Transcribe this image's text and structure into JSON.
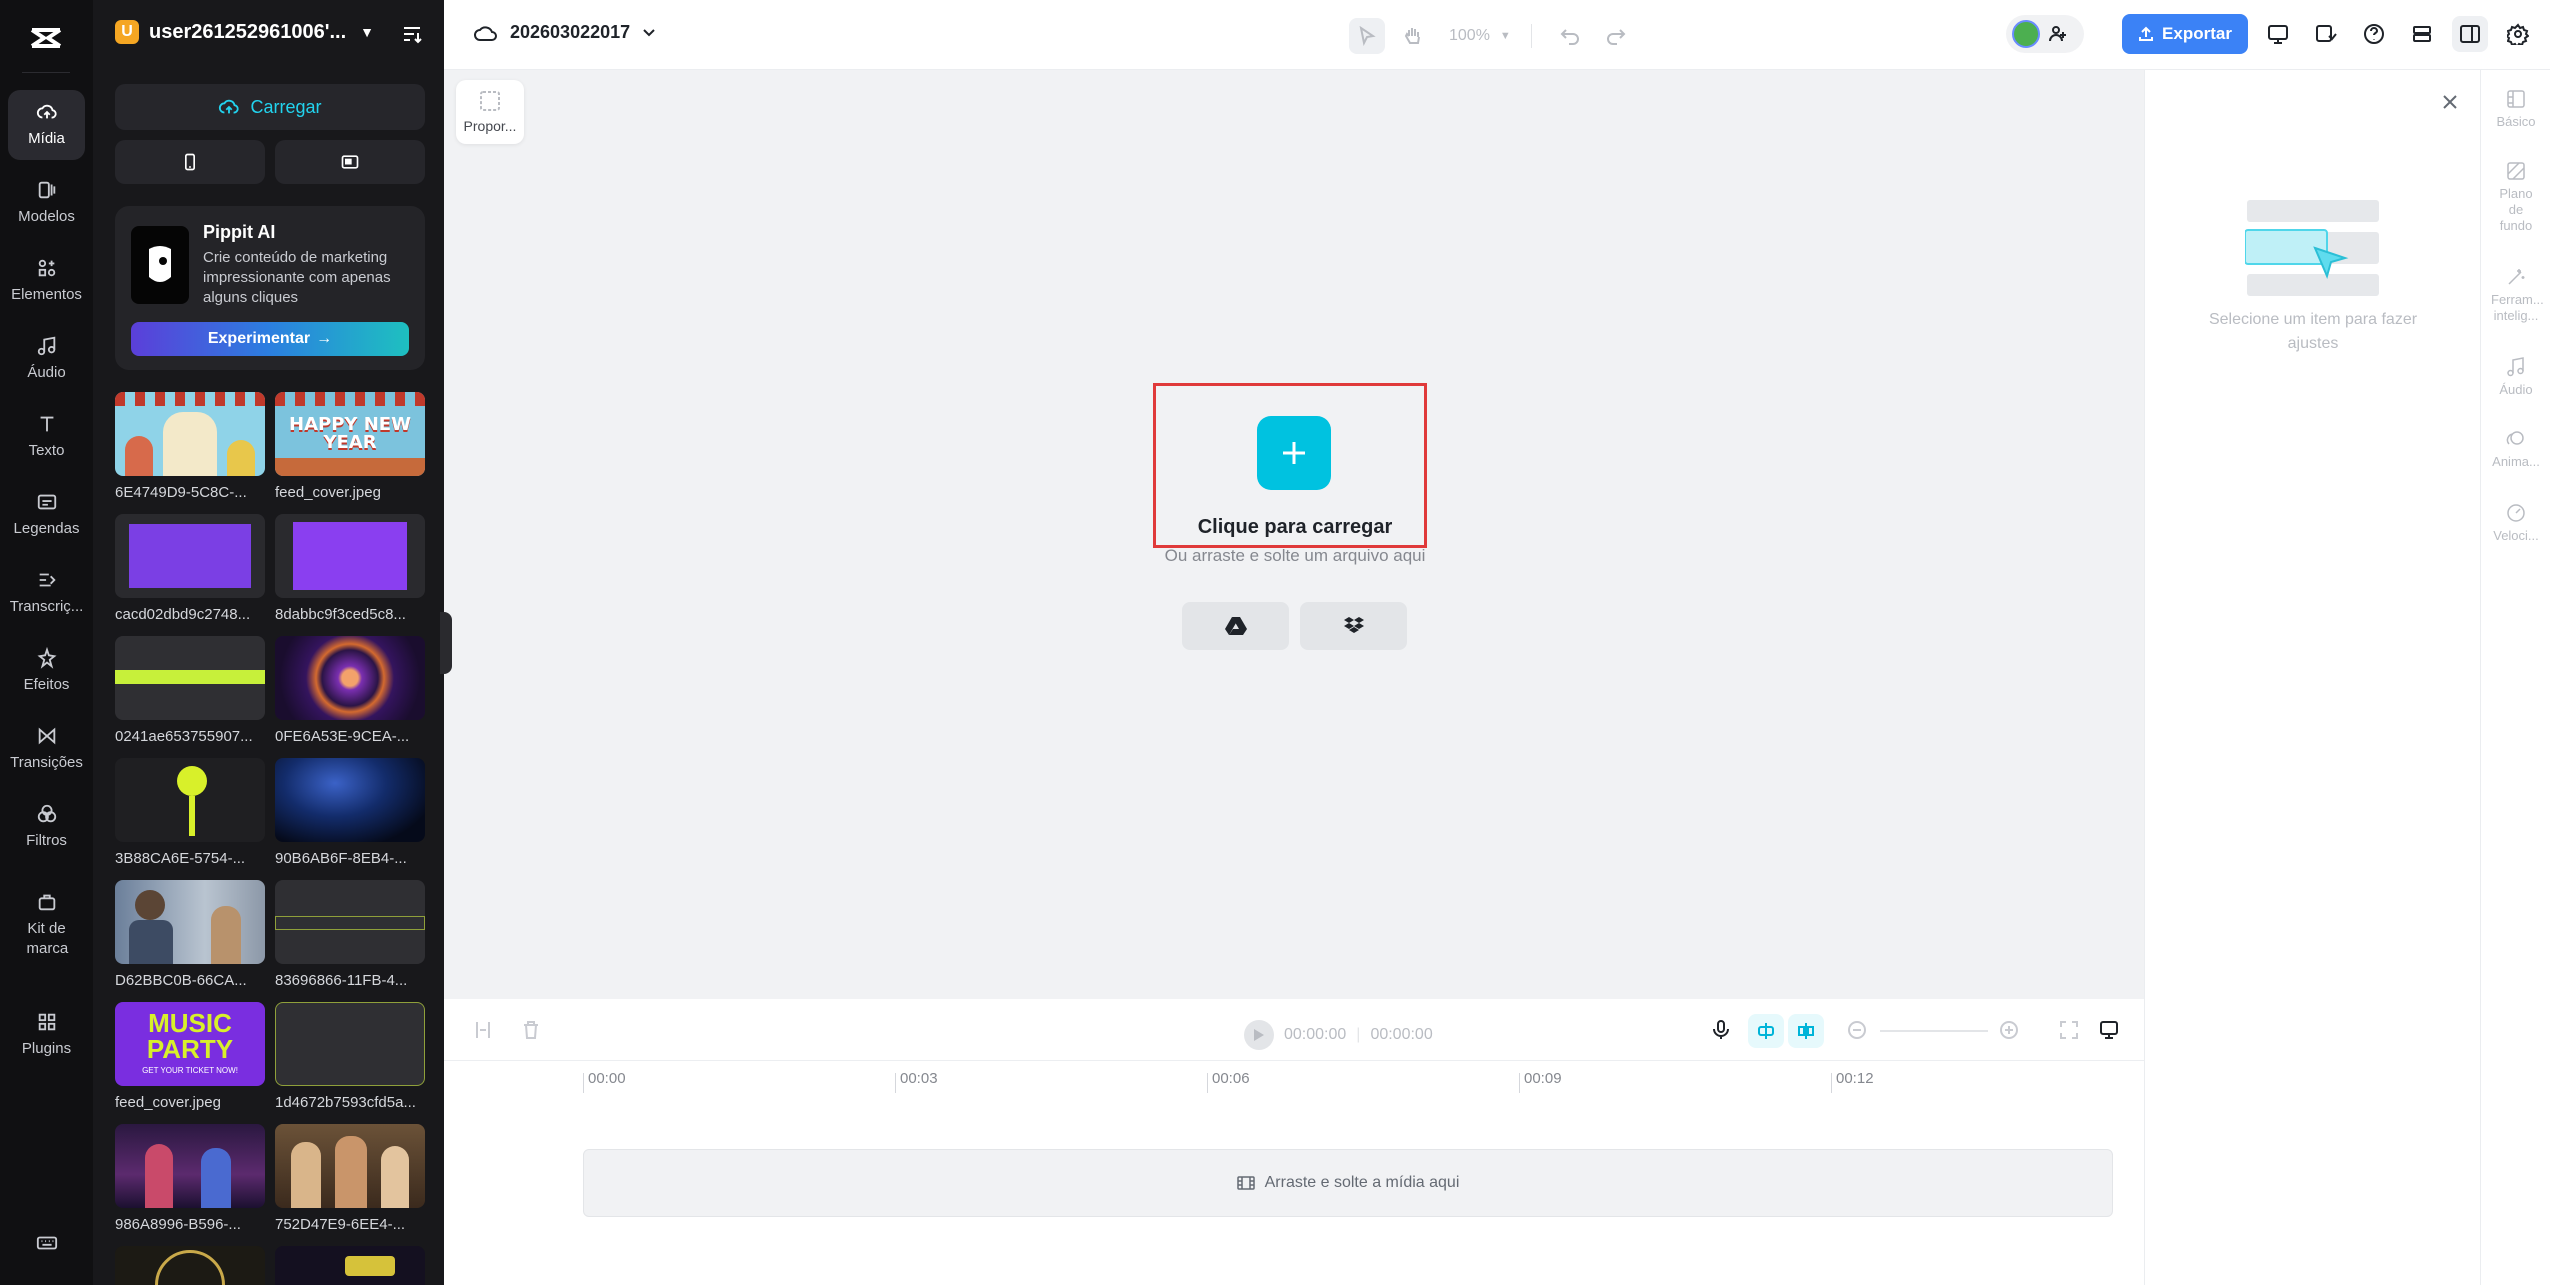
{
  "brand": {
    "accent": "#00c2e0",
    "export_color": "#3b82f6",
    "highlight": "#e03a3a"
  },
  "rail": {
    "items": [
      {
        "label": "Mídia",
        "icon": "cloud-upload-icon",
        "active": true
      },
      {
        "label": "Modelos",
        "icon": "templates-icon"
      },
      {
        "label": "Elementos",
        "icon": "elements-icon"
      },
      {
        "label": "Áudio",
        "icon": "music-note-icon"
      },
      {
        "label": "Texto",
        "icon": "text-icon"
      },
      {
        "label": "Legendas",
        "icon": "captions-icon"
      },
      {
        "label": "Transcriç...",
        "icon": "transcript-icon"
      },
      {
        "label": "Efeitos",
        "icon": "effects-icon"
      },
      {
        "label": "Transições",
        "icon": "transitions-icon"
      },
      {
        "label": "Filtros",
        "icon": "filters-icon"
      },
      {
        "label": "Kit de marca",
        "icon": "brand-kit-icon"
      },
      {
        "label": "Plugins",
        "icon": "plugins-icon"
      }
    ]
  },
  "panel": {
    "workspace_initial": "U",
    "workspace_name": "user261252961006'...",
    "upload_label": "Carregar",
    "promo": {
      "title": "Pippit AI",
      "description": "Crie conteúdo de marketing impressionante com apenas alguns cliques",
      "button": "Experimentar"
    },
    "media": [
      "6E4749D9-5C8C-...",
      "feed_cover.jpeg",
      "cacd02dbd9c2748...",
      "8dabbc9f3ced5c8...",
      "0241ae653755907...",
      "0FE6A53E-9CEA-...",
      "3B88CA6E-5754-...",
      "90B6AB6F-8EB4-...",
      "D62BBC0B-66CA...",
      "83696866-11FB-4...",
      "feed_cover.jpeg",
      "1d4672b7593cfd5a...",
      "986A8996-B596-...",
      "752D47E9-6EE4-...",
      "",
      ""
    ],
    "music_party": {
      "line1": "MUSIC",
      "line2": "PARTY",
      "line3": "GET YOUR TICKET NOW!"
    },
    "happy_new_year": "HAPPY NEW YEAR"
  },
  "topbar": {
    "project_title": "202603022017",
    "zoom": "100%",
    "export_label": "Exportar"
  },
  "canvas": {
    "proportion_label": "Propor...",
    "upload_title": "Clique para carregar",
    "upload_subtitle": "Ou arraste e solte um arquivo aqui"
  },
  "timeline": {
    "current_time": "00:00:00",
    "total_time": "00:00:00",
    "ticks": [
      "00:00",
      "00:03",
      "00:06",
      "00:09",
      "00:12"
    ],
    "drop_hint": "Arraste e solte a mídia aqui"
  },
  "inspector": {
    "empty_text": "Selecione um item para fazer ajustes",
    "tabs": [
      "Básico",
      "Plano de fundo",
      "Ferram... intelig...",
      "Áudio",
      "Anima...",
      "Veloci..."
    ]
  }
}
